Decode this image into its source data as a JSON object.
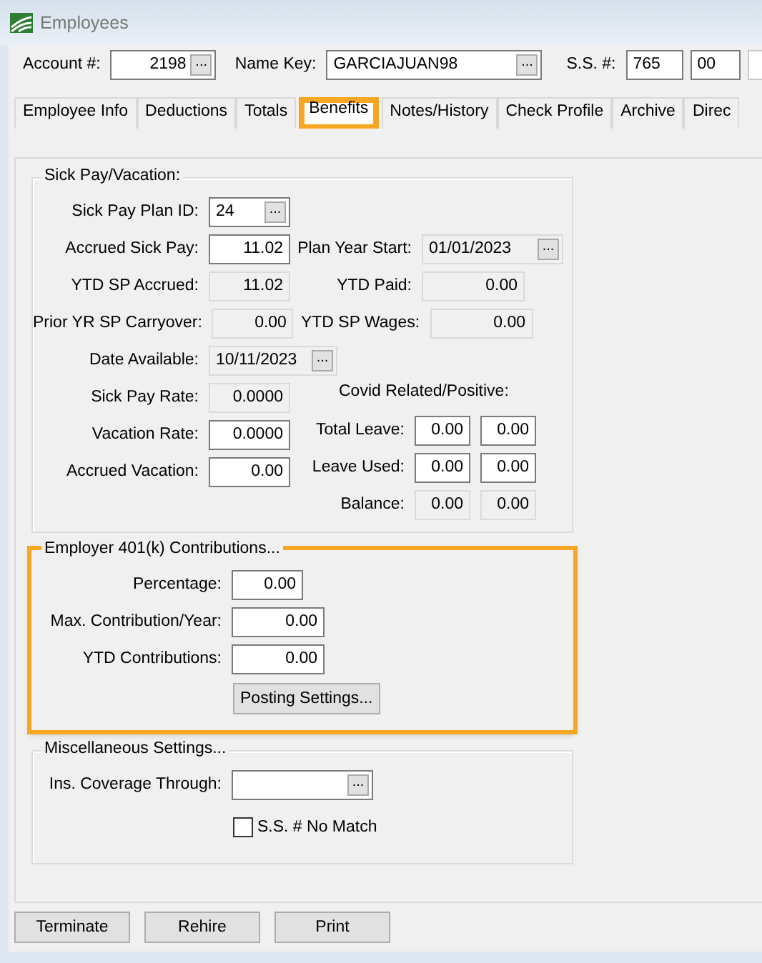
{
  "window": {
    "title": "Employees"
  },
  "header": {
    "account": {
      "label": "Account #:",
      "value": "2198",
      "button": "..."
    },
    "name_key": {
      "label": "Name Key:",
      "value": "GARCIAJUAN98",
      "button": "..."
    },
    "ss": {
      "label": "S.S. #:",
      "parts": [
        "765",
        "00"
      ]
    }
  },
  "tabs": [
    {
      "label": "Employee Info",
      "selected": false,
      "highlighted": false
    },
    {
      "label": "Deductions",
      "selected": false,
      "highlighted": false
    },
    {
      "label": "Totals",
      "selected": false,
      "highlighted": false
    },
    {
      "label": "Benefits",
      "selected": true,
      "highlighted": true
    },
    {
      "label": "Notes/History",
      "selected": false,
      "highlighted": false
    },
    {
      "label": "Check Profile",
      "selected": false,
      "highlighted": false
    },
    {
      "label": "Archive",
      "selected": false,
      "highlighted": false
    },
    {
      "label": "Direc",
      "selected": false,
      "highlighted": false
    }
  ],
  "sick_pay": {
    "title": "Sick Pay/Vacation:",
    "rows": [
      {
        "left": {
          "label": "Sick Pay Plan ID:",
          "value": "24",
          "editable": true,
          "button": "..."
        }
      },
      {
        "left": {
          "label": "Accrued Sick Pay:",
          "value": "11.02",
          "editable": true
        },
        "right": {
          "label": "Plan Year Start:",
          "value": "01/01/2023",
          "editable": false,
          "button": "..."
        }
      },
      {
        "left": {
          "label": "YTD SP Accrued:",
          "value": "11.02",
          "editable": false
        },
        "right": {
          "label": "YTD Paid:",
          "value": "0.00",
          "editable": false
        }
      },
      {
        "left": {
          "label": "Prior YR SP Carryover:",
          "value": "0.00",
          "editable": false
        },
        "right": {
          "label": "YTD SP Wages:",
          "value": "0.00",
          "editable": false
        }
      },
      {
        "left": {
          "label": "Date Available:",
          "value": "10/11/2023",
          "editable": false,
          "button": "..."
        }
      }
    ],
    "rates": [
      {
        "label": "Sick Pay Rate:",
        "value": "0.0000",
        "editable": false
      },
      {
        "label": "Vacation Rate:",
        "value": "0.0000",
        "editable": true
      },
      {
        "label": "Accrued Vacation:",
        "value": "0.00",
        "editable": true
      }
    ],
    "covid": {
      "title": "Covid Related/Positive:",
      "rows": [
        {
          "label": "Total Leave:",
          "values": [
            "0.00",
            "0.00"
          ],
          "editable": true
        },
        {
          "label": "Leave Used:",
          "values": [
            "0.00",
            "0.00"
          ],
          "editable": true
        },
        {
          "label": "Balance:",
          "values": [
            "0.00",
            "0.00"
          ],
          "editable": false
        }
      ]
    }
  },
  "employer_401k": {
    "title": "Employer 401(k) Contributions...",
    "highlighted": true,
    "fields": [
      {
        "label": "Percentage:",
        "value": "0.00",
        "editable": true
      },
      {
        "label": "Max. Contribution/Year:",
        "value": "0.00",
        "editable": true
      },
      {
        "label": "YTD Contributions:",
        "value": "0.00",
        "editable": true
      }
    ],
    "button": "Posting Settings..."
  },
  "misc": {
    "title": "Miscellaneous Settings...",
    "fields": [
      {
        "label": "Ins. Coverage Through:",
        "editable": true,
        "button": "..."
      }
    ],
    "checkbox": {
      "label": "S.S. # No Match",
      "checked": false
    }
  },
  "buttons": [
    "Terminate",
    "Rehire",
    "Print"
  ]
}
